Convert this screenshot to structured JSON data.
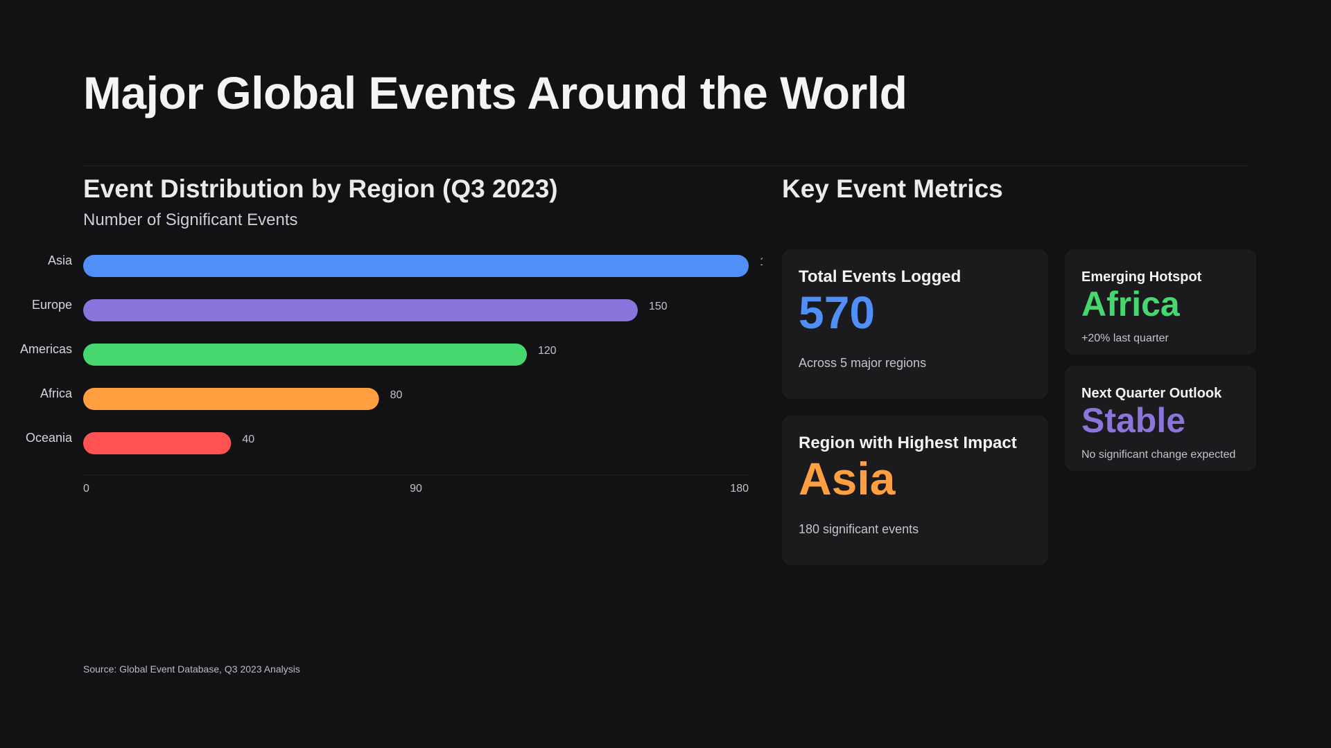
{
  "page": {
    "title": "Major Global Events Around the World",
    "source": "Source: Global Event Database, Q3 2023 Analysis"
  },
  "chart_data": {
    "type": "bar",
    "orientation": "horizontal",
    "title": "Event Distribution by Region (Q3 2023)",
    "subtitle": "Number of Significant Events",
    "categories": [
      "Asia",
      "Europe",
      "Americas",
      "Africa",
      "Oceania"
    ],
    "values": [
      180,
      150,
      120,
      80,
      40
    ],
    "colors": [
      "#4f8ff7",
      "#8b74dc",
      "#46d86e",
      "#ff9f40",
      "#ff5252"
    ],
    "xlim": [
      0,
      180
    ],
    "xticks": [
      "0",
      "90",
      "180"
    ],
    "grid": false,
    "legend": "none"
  },
  "metrics": {
    "title": "Key Event Metrics",
    "cards": [
      {
        "label": "Total Events Logged",
        "value": "570",
        "note": "Across 5 major regions",
        "color": "#4f8ff7"
      },
      {
        "label": "Region with Highest Impact",
        "value": "Asia",
        "note": "180 significant events",
        "color": "#ff9f40"
      },
      {
        "label": "Emerging Hotspot",
        "value": "Africa",
        "note": "+20% last quarter",
        "color": "#46d86e"
      },
      {
        "label": "Next Quarter Outlook",
        "value": "Stable",
        "note": "No significant change expected",
        "color": "#8b74dc"
      }
    ]
  }
}
